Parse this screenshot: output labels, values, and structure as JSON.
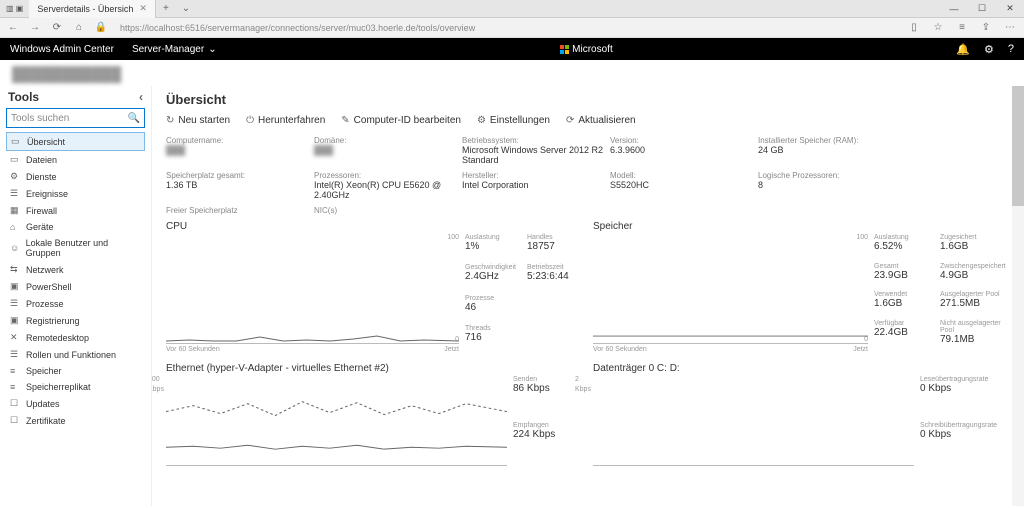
{
  "browser": {
    "tab_title": "Serverdetails - Übersich",
    "url": "https://localhost:6516/servermanager/connections/server/muc03.hoerle.de/tools/overview"
  },
  "appbar": {
    "brand": "Windows Admin Center",
    "context": "Server-Manager",
    "center": "Microsoft"
  },
  "server_name": "███████████",
  "tools": {
    "header": "Tools",
    "search_placeholder": "Tools suchen",
    "items": [
      {
        "label": "Übersicht",
        "icon": "▭",
        "active": true
      },
      {
        "label": "Dateien",
        "icon": "▭"
      },
      {
        "label": "Dienste",
        "icon": "⚙"
      },
      {
        "label": "Ereignisse",
        "icon": "☰"
      },
      {
        "label": "Firewall",
        "icon": "▦"
      },
      {
        "label": "Geräte",
        "icon": "⌂"
      },
      {
        "label": "Lokale Benutzer und Gruppen",
        "icon": "☺"
      },
      {
        "label": "Netzwerk",
        "icon": "⇆"
      },
      {
        "label": "PowerShell",
        "icon": "▣"
      },
      {
        "label": "Prozesse",
        "icon": "☰"
      },
      {
        "label": "Registrierung",
        "icon": "▣"
      },
      {
        "label": "Remotedesktop",
        "icon": "✕"
      },
      {
        "label": "Rollen und Funktionen",
        "icon": "☰"
      },
      {
        "label": "Speicher",
        "icon": "≡"
      },
      {
        "label": "Speicherreplikat",
        "icon": "≡"
      },
      {
        "label": "Updates",
        "icon": "☐"
      },
      {
        "label": "Zertifikate",
        "icon": "☐"
      }
    ]
  },
  "page_title": "Übersicht",
  "actions": [
    {
      "icon": "↻",
      "label": "Neu starten"
    },
    {
      "icon": "⏻",
      "label": "Herunterfahren"
    },
    {
      "icon": "✎",
      "label": "Computer-ID bearbeiten"
    },
    {
      "icon": "⚙",
      "label": "Einstellungen"
    },
    {
      "icon": "⟳",
      "label": "Aktualisieren"
    }
  ],
  "info": {
    "row1": [
      {
        "lbl": "Computername:",
        "val": "███",
        "blur": true
      },
      {
        "lbl": "Domäne:",
        "val": "███",
        "blur": true
      },
      {
        "lbl": "Betriebssystem:",
        "val": "Microsoft Windows Server 2012 R2 Standard"
      },
      {
        "lbl": "Version:",
        "val": "6.3.9600"
      },
      {
        "lbl": "Installierter Speicher (RAM):",
        "val": "24 GB"
      }
    ],
    "row2": [
      {
        "lbl": "Speicherplatz gesamt:",
        "val": "1.36 TB"
      },
      {
        "lbl": "Prozessoren:",
        "val": "Intel(R) Xeon(R) CPU E5620 @ 2.40GHz"
      },
      {
        "lbl": "Hersteller:",
        "val": "Intel Corporation"
      },
      {
        "lbl": "Modell:",
        "val": "S5520HC"
      },
      {
        "lbl": "Logische Prozessoren:",
        "val": "8"
      }
    ],
    "row3": [
      {
        "lbl": "Freier Speicherplatz",
        "val": ""
      },
      {
        "lbl": "NIC(s)",
        "val": ""
      },
      {
        "lbl": "",
        "val": ""
      },
      {
        "lbl": "",
        "val": ""
      },
      {
        "lbl": "",
        "val": ""
      }
    ]
  },
  "cpu": {
    "title": "CPU",
    "ymax": "100",
    "ymin": "0",
    "tl": "Vor 60 Sekunden",
    "tr": "Jetzt",
    "stats": [
      {
        "lbl": "Auslastung",
        "val": "1%"
      },
      {
        "lbl": "Handles",
        "val": "18757"
      },
      {
        "lbl": "Geschwindigkeit",
        "val": "2.4GHz"
      },
      {
        "lbl": "Betriebszeit",
        "val": "5:23:6:44"
      },
      {
        "lbl": "Prozesse",
        "val": "46"
      },
      {
        "lbl": "",
        "val": ""
      },
      {
        "lbl": "Threads",
        "val": "716"
      }
    ]
  },
  "mem": {
    "title": "Speicher",
    "ymax": "100",
    "ymin": "0",
    "tl": "Vor 60 Sekunden",
    "tr": "Jetzt",
    "stats": [
      {
        "lbl": "Auslastung",
        "val": "6.52%"
      },
      {
        "lbl": "Zugesichert",
        "val": "1.6GB"
      },
      {
        "lbl": "Gesamt",
        "val": "23.9GB"
      },
      {
        "lbl": "Zwischengespeichert",
        "val": "4.9GB"
      },
      {
        "lbl": "Verwendet",
        "val": "1.6GB"
      },
      {
        "lbl": "Ausgelagerter Pool",
        "val": "271.5MB"
      },
      {
        "lbl": "Verfügbar",
        "val": "22.4GB"
      },
      {
        "lbl": "Nicht ausgelagerter Pool",
        "val": "79.1MB"
      }
    ]
  },
  "net": {
    "title": "Ethernet (hyper-V-Adapter - virtuelles Ethernet #2)",
    "ymax": "100",
    "unit": "Kbps",
    "stats": [
      {
        "lbl": "Senden",
        "val": "86 Kbps"
      },
      {
        "lbl": "Empfangen",
        "val": "224 Kbps"
      }
    ]
  },
  "disk": {
    "title": "Datenträger 0 C: D:",
    "ymax": "2",
    "unit": "Kbps",
    "stats": [
      {
        "lbl": "Leseübertragungsrate",
        "val": "0 Kbps"
      },
      {
        "lbl": "Schreibübertragungsrate",
        "val": "0 Kbps"
      }
    ]
  },
  "chart_data": [
    {
      "type": "line",
      "title": "CPU",
      "xlabel": "Vor 60 Sekunden → Jetzt",
      "ylabel": "Auslastung %",
      "ylim": [
        0,
        100
      ],
      "x": [
        0,
        5,
        10,
        15,
        20,
        25,
        30,
        35,
        40,
        45,
        50,
        55,
        60
      ],
      "values": [
        1,
        2,
        1,
        1,
        5,
        1,
        2,
        1,
        3,
        6,
        1,
        2,
        1
      ]
    },
    {
      "type": "line",
      "title": "Speicher",
      "xlabel": "Vor 60 Sekunden → Jetzt",
      "ylabel": "Auslastung %",
      "ylim": [
        0,
        100
      ],
      "x": [
        0,
        60
      ],
      "values": [
        6.5,
        6.5
      ]
    },
    {
      "type": "line",
      "title": "Ethernet (hyper-V-Adapter - virtuelles Ethernet #2)",
      "xlabel": "",
      "ylabel": "Kbps",
      "ylim": [
        0,
        100
      ],
      "series": [
        {
          "name": "Senden",
          "values": [
            20,
            22,
            20,
            25,
            18,
            22,
            20,
            24,
            19,
            21,
            20,
            22,
            20
          ]
        },
        {
          "name": "Empfangen",
          "values": [
            60,
            70,
            55,
            72,
            50,
            75,
            58,
            73,
            54,
            70,
            56,
            72,
            55
          ]
        }
      ],
      "x": [
        0,
        5,
        10,
        15,
        20,
        25,
        30,
        35,
        40,
        45,
        50,
        55,
        60
      ]
    },
    {
      "type": "line",
      "title": "Datenträger 0 C: D:",
      "xlabel": "",
      "ylabel": "Kbps",
      "ylim": [
        0,
        2
      ],
      "series": [
        {
          "name": "Leseübertragungsrate",
          "values": [
            0,
            0
          ]
        },
        {
          "name": "Schreibübertragungsrate",
          "values": [
            0,
            0
          ]
        }
      ],
      "x": [
        0,
        60
      ]
    }
  ]
}
